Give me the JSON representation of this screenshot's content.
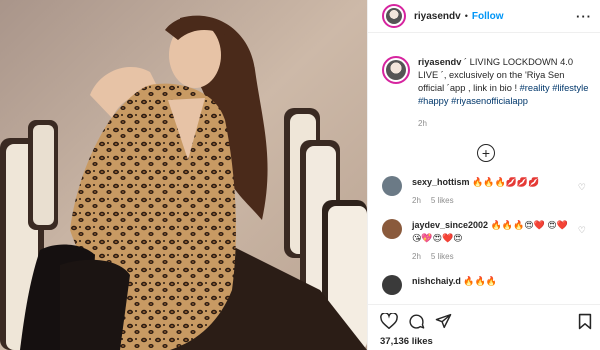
{
  "post": {
    "username": "riyasendv",
    "separator": "•",
    "follow_label": "Follow",
    "more_label": "···",
    "caption_text": " ´ LIVING LOCKDOWN 4.0 LIVE ´, exclusively on the 'Riya Sen official ´app , link in bio ! ",
    "hashtags": "#reality #lifestyle #happy #riyasenofficialapp",
    "caption_time": "2h",
    "load_more_label": "+",
    "likes": "37,136 likes"
  },
  "comments": [
    {
      "user": "sexy_hottism",
      "text": "🔥🔥🔥💋💋💋",
      "time": "2h",
      "likes": "5 likes",
      "avatar_color": "#6b7a86"
    },
    {
      "user": "jaydev_since2002",
      "text": "🔥🔥🔥😍❤️ 😍❤️😘💖😍❤️😍",
      "time": "2h",
      "likes": "5 likes",
      "avatar_color": "#8a5a3c"
    },
    {
      "user": "nishchaiy.d",
      "text": "🔥🔥🔥",
      "time": "",
      "likes": "",
      "avatar_color": "#3a3a3a"
    }
  ],
  "icons": {
    "more": "more-options-icon",
    "like": "heart-icon",
    "comment": "comment-icon",
    "share": "share-icon",
    "save": "bookmark-icon",
    "comment_like": "small-heart-icon"
  },
  "colors": {
    "follow": "#0095f6",
    "hashtag": "#00376b",
    "muted": "#8e8e8e",
    "avatar_ring": "#d6249f"
  }
}
